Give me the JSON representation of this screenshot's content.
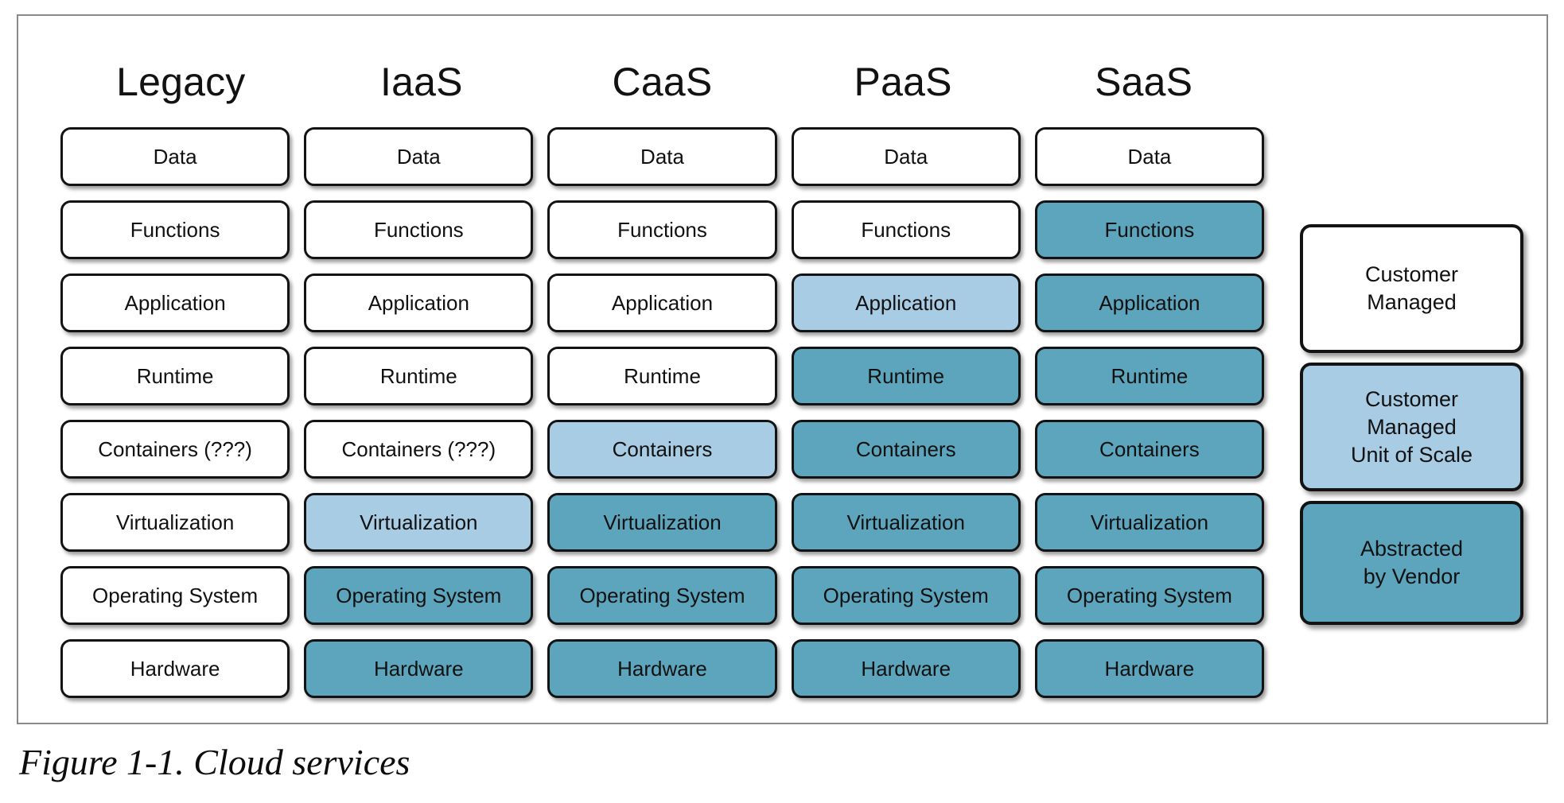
{
  "figure": {
    "caption": "Figure 1-1. Cloud services"
  },
  "colors": {
    "white": "#ffffff",
    "light_blue": "#a9cce5",
    "teal": "#5ca5bd",
    "border": "#131313",
    "frame": "#8a8a8a"
  },
  "columns": [
    {
      "label": "Legacy"
    },
    {
      "label": "IaaS"
    },
    {
      "label": "CaaS"
    },
    {
      "label": "PaaS"
    },
    {
      "label": "SaaS"
    }
  ],
  "rows": [
    {
      "name": "data",
      "cells": [
        {
          "label": "Data",
          "fill": "white"
        },
        {
          "label": "Data",
          "fill": "white"
        },
        {
          "label": "Data",
          "fill": "white"
        },
        {
          "label": "Data",
          "fill": "white"
        },
        {
          "label": "Data",
          "fill": "white"
        }
      ]
    },
    {
      "name": "functions",
      "cells": [
        {
          "label": "Functions",
          "fill": "white"
        },
        {
          "label": "Functions",
          "fill": "white"
        },
        {
          "label": "Functions",
          "fill": "white"
        },
        {
          "label": "Functions",
          "fill": "white"
        },
        {
          "label": "Functions",
          "fill": "teal"
        }
      ]
    },
    {
      "name": "application",
      "cells": [
        {
          "label": "Application",
          "fill": "white"
        },
        {
          "label": "Application",
          "fill": "white"
        },
        {
          "label": "Application",
          "fill": "white"
        },
        {
          "label": "Application",
          "fill": "light"
        },
        {
          "label": "Application",
          "fill": "teal"
        }
      ]
    },
    {
      "name": "runtime",
      "cells": [
        {
          "label": "Runtime",
          "fill": "white"
        },
        {
          "label": "Runtime",
          "fill": "white"
        },
        {
          "label": "Runtime",
          "fill": "white"
        },
        {
          "label": "Runtime",
          "fill": "teal"
        },
        {
          "label": "Runtime",
          "fill": "teal"
        }
      ]
    },
    {
      "name": "containers",
      "cells": [
        {
          "label": "Containers (???)",
          "fill": "white"
        },
        {
          "label": "Containers (???)",
          "fill": "white"
        },
        {
          "label": "Containers",
          "fill": "light"
        },
        {
          "label": "Containers",
          "fill": "teal"
        },
        {
          "label": "Containers",
          "fill": "teal"
        }
      ]
    },
    {
      "name": "virtualization",
      "cells": [
        {
          "label": "Virtualization",
          "fill": "white"
        },
        {
          "label": "Virtualization",
          "fill": "light"
        },
        {
          "label": "Virtualization",
          "fill": "teal"
        },
        {
          "label": "Virtualization",
          "fill": "teal"
        },
        {
          "label": "Virtualization",
          "fill": "teal"
        }
      ]
    },
    {
      "name": "operating-system",
      "cells": [
        {
          "label": "Operating System",
          "fill": "white"
        },
        {
          "label": "Operating System",
          "fill": "teal"
        },
        {
          "label": "Operating System",
          "fill": "teal"
        },
        {
          "label": "Operating System",
          "fill": "teal"
        },
        {
          "label": "Operating System",
          "fill": "teal"
        }
      ]
    },
    {
      "name": "hardware",
      "cells": [
        {
          "label": "Hardware",
          "fill": "white"
        },
        {
          "label": "Hardware",
          "fill": "teal"
        },
        {
          "label": "Hardware",
          "fill": "teal"
        },
        {
          "label": "Hardware",
          "fill": "teal"
        },
        {
          "label": "Hardware",
          "fill": "teal"
        }
      ]
    }
  ],
  "legend": [
    {
      "name": "customer-managed",
      "lines": [
        "Customer",
        "Managed"
      ],
      "fill": "white"
    },
    {
      "name": "customer-managed-unit-of-scale",
      "lines": [
        "Customer",
        "Managed",
        "Unit of Scale"
      ],
      "fill": "light"
    },
    {
      "name": "abstracted-by-vendor",
      "lines": [
        "Abstracted",
        "by Vendor"
      ],
      "fill": "teal"
    }
  ]
}
